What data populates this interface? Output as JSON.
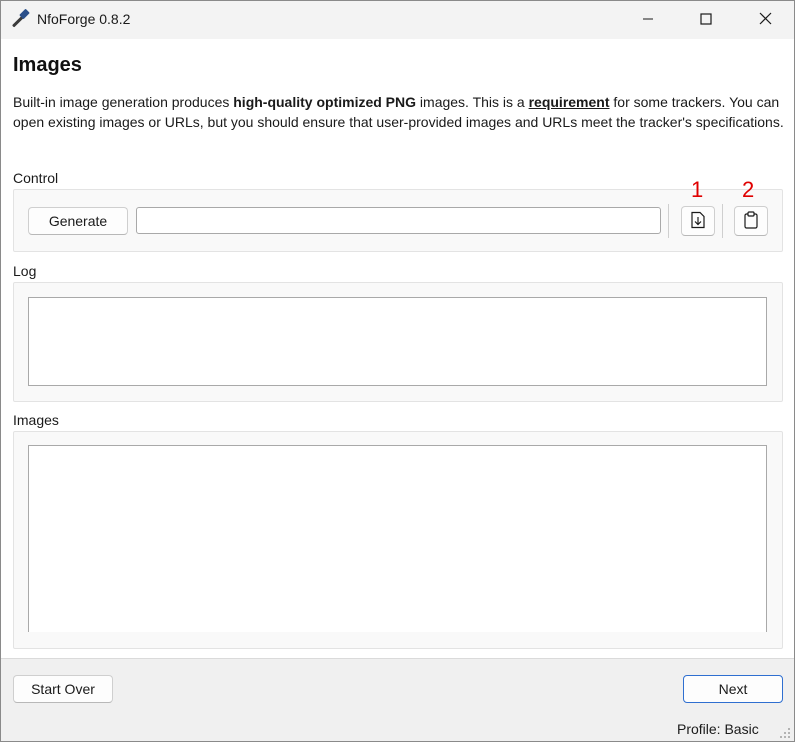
{
  "window": {
    "title": "NfoForge 0.8.2",
    "icon": "hammer-icon",
    "controls": [
      "minimize-icon",
      "maximize-icon",
      "close-icon"
    ]
  },
  "page": {
    "heading": "Images",
    "description": {
      "part1": "Built-in image generation produces ",
      "bold1": "high-quality optimized PNG",
      "part2": " images. This is a ",
      "underline1": "requirement",
      "part3": " for some trackers. You can open existing images or URLs, but you should ensure that user-provided images and URLs meet the tracker's specifications."
    }
  },
  "control": {
    "label": "Control",
    "generate_label": "Generate",
    "url_value": "",
    "open_icon": "file-download-icon",
    "paste_icon": "clipboard-icon",
    "annotation_1": "1",
    "annotation_2": "2"
  },
  "log": {
    "label": "Log",
    "content": ""
  },
  "images": {
    "label": "Images",
    "content": ""
  },
  "footer": {
    "start_over_label": "Start Over",
    "next_label": "Next",
    "profile_text": "Profile: Basic"
  },
  "colors": {
    "annotation": "#e00000",
    "primary_border": "#2f6fd0"
  }
}
